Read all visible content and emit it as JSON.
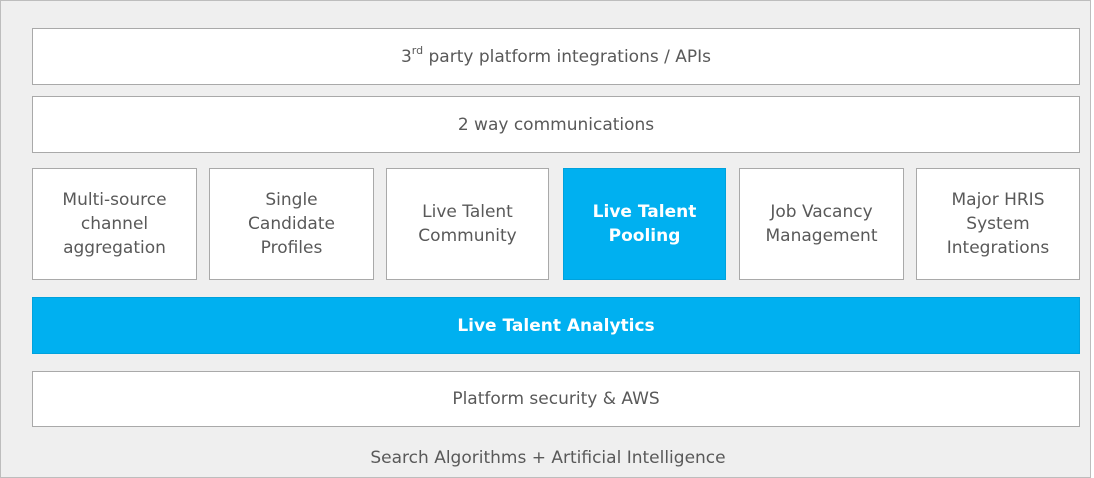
{
  "layers": {
    "integrations": {
      "prefix": "3",
      "superscript": "rd",
      "rest": " party platform integrations / APIs"
    },
    "communications": "2 way communications",
    "modules": [
      "Multi-source\nchannel\naggregation",
      "Single\nCandidate\nProfiles",
      "Live Talent\nCommunity",
      "Live Talent\nPooling",
      "Job Vacancy\nManagement",
      "Major HRIS\nSystem\nIntegrations"
    ],
    "highlighted_module_index": 3,
    "analytics": "Live Talent Analytics",
    "security": "Platform security & AWS",
    "foundation": "Search Algorithms + Artificial Intelligence"
  },
  "colors": {
    "highlight": "#00b0f0",
    "box_text": "#595959",
    "background": "#efefef"
  }
}
